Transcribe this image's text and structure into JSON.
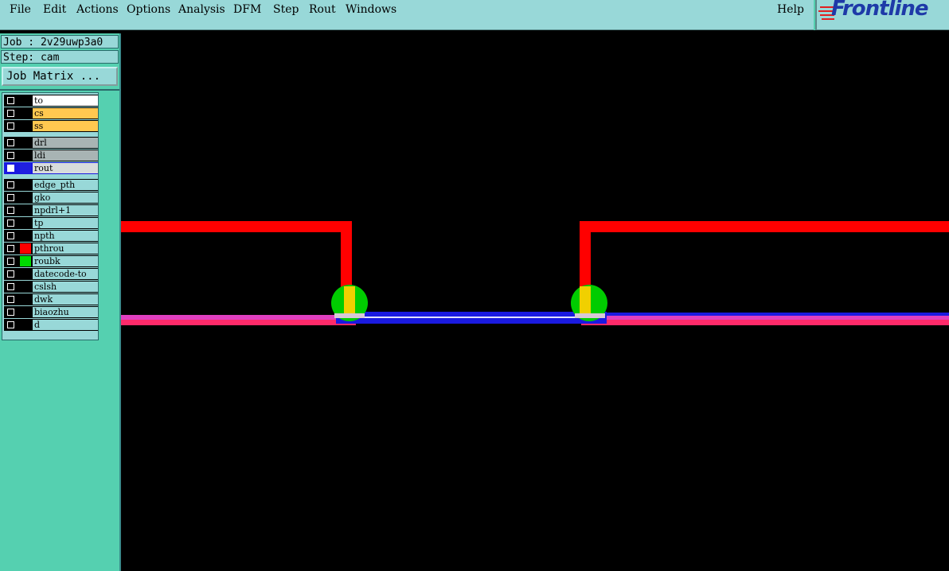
{
  "menu": {
    "file": "File",
    "edit": "Edit",
    "actions": "Actions",
    "options": "Options",
    "analysis": "Analysis",
    "dfm": "DFM",
    "step": "Step",
    "rout": "Rout",
    "windows": "Windows",
    "help": "Help"
  },
  "logo": {
    "text": "Frontline"
  },
  "job": {
    "label": "Job : 2v29uwp3a0",
    "step": "Step: cam",
    "matrix_button": "Job Matrix ..."
  },
  "layers": [
    {
      "name": "to",
      "bg": "#ffffff",
      "swatch": "#000000"
    },
    {
      "name": "cs",
      "bg": "#ffc850",
      "swatch": "#000000"
    },
    {
      "name": "ss",
      "bg": "#ffc850",
      "swatch": "#000000"
    },
    {
      "name": "drl",
      "bg": "#a8b4b4",
      "swatch": "#000000"
    },
    {
      "name": "ldi",
      "bg": "#a8b4b4",
      "swatch": "#000000"
    },
    {
      "name": "rout",
      "bg": "#d8dcdc",
      "swatch": "#2020e0"
    },
    {
      "name": "edge_pth",
      "bg": "#98d8d8",
      "swatch": "#000000"
    },
    {
      "name": "gko",
      "bg": "#98d8d8",
      "swatch": "#000000"
    },
    {
      "name": "npdrl+1",
      "bg": "#98d8d8",
      "swatch": "#000000"
    },
    {
      "name": "tp",
      "bg": "#98d8d8",
      "swatch": "#000000"
    },
    {
      "name": "npth",
      "bg": "#98d8d8",
      "swatch": "#000000"
    },
    {
      "name": "pthrou",
      "bg": "#98d8d8",
      "swatch": "#ff0000"
    },
    {
      "name": "roubk",
      "bg": "#98d8d8",
      "swatch": "#00dd00"
    },
    {
      "name": "datecode-to",
      "bg": "#98d8d8",
      "swatch": "#000000"
    },
    {
      "name": "cslsh",
      "bg": "#98d8d8",
      "swatch": "#000000"
    },
    {
      "name": "dwk",
      "bg": "#98d8d8",
      "swatch": "#000000"
    },
    {
      "name": "biaozhu",
      "bg": "#98d8d8",
      "swatch": "#000000"
    },
    {
      "name": "d",
      "bg": "#98d8d8",
      "swatch": "#000000"
    }
  ],
  "colors": {
    "trace": "#ff0000",
    "rout": "#1a1ae0",
    "pad": "#00cc00",
    "overlap": "#f0d000",
    "magenta": "#e040c0"
  }
}
